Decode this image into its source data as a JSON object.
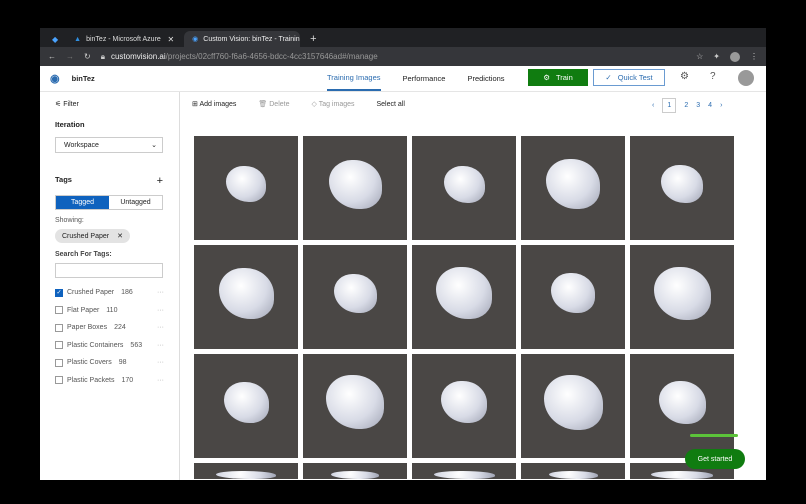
{
  "browser": {
    "tabs": [
      {
        "label": "binTez - Microsoft Azure"
      },
      {
        "label": "Custom Vision: binTez - Trainin"
      }
    ],
    "url_host": "customvision.ai",
    "url_path": "/projects/02cff760-f6a6-4656-bdcc-4cc3157646ad#/manage"
  },
  "app": {
    "project": "binTez",
    "nav": [
      "Training Images",
      "Performance",
      "Predictions"
    ],
    "train": "Train",
    "quick_test": "Quick Test",
    "accent": "#107c10"
  },
  "sidebar": {
    "filter": "Filter",
    "iteration_label": "Iteration",
    "iteration_value": "Workspace",
    "tags_label": "Tags",
    "tagged": "Tagged",
    "untagged": "Untagged",
    "showing": "Showing:",
    "chip": "Crushed Paper",
    "search_label": "Search For Tags:",
    "tags": [
      {
        "name": "Crushed Paper",
        "count": "186",
        "checked": true
      },
      {
        "name": "Flat Paper",
        "count": "110"
      },
      {
        "name": "Paper Boxes",
        "count": "224"
      },
      {
        "name": "Plastic Containers",
        "count": "563"
      },
      {
        "name": "Plastic Covers",
        "count": "98"
      },
      {
        "name": "Plastic Packets",
        "count": "170"
      }
    ]
  },
  "toolbar": {
    "add": "Add images",
    "delete": "Delete",
    "tag": "Tag images",
    "select_all": "Select all"
  },
  "pager": {
    "prev": "‹",
    "pages": [
      "1",
      "2",
      "3",
      "4"
    ],
    "next": "›",
    "current": "1"
  },
  "get_started": "Get started"
}
